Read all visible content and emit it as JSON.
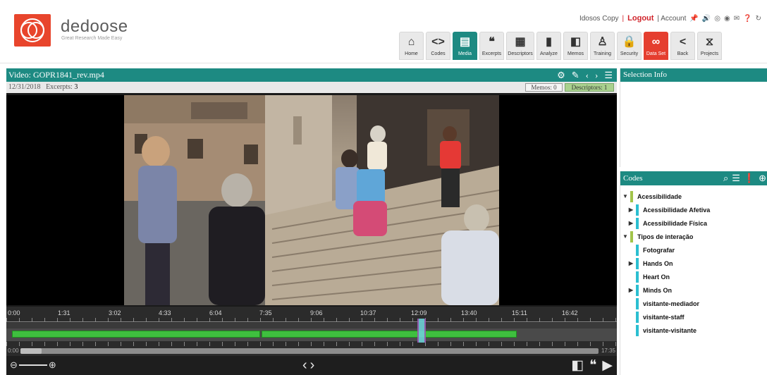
{
  "brand": {
    "name": "dedoose",
    "tagline": "Great Research Made Easy"
  },
  "top_links": {
    "user": "Idosos Copy",
    "separator": "|",
    "logout": "Logout",
    "account": "| Account"
  },
  "nav": [
    {
      "label": "Home",
      "icon": "home-icon"
    },
    {
      "label": "Codes",
      "icon": "codes-icon"
    },
    {
      "label": "Media",
      "icon": "media-icon",
      "active": true
    },
    {
      "label": "Excerpts",
      "icon": "quote-icon"
    },
    {
      "label": "Descriptors",
      "icon": "clipboard-icon"
    },
    {
      "label": "Analyze",
      "icon": "bar-chart-icon"
    },
    {
      "label": "Memos",
      "icon": "memo-icon"
    },
    {
      "label": "Training",
      "icon": "training-icon"
    },
    {
      "label": "Security",
      "icon": "lock-icon"
    },
    {
      "label": "Data Set",
      "icon": "binoculars-icon"
    },
    {
      "label": "Back",
      "icon": "back-icon"
    },
    {
      "label": "Projects",
      "icon": "projects-icon"
    }
  ],
  "video": {
    "title": "Video: GOPR1841_rev.mp4",
    "date": "12/31/2018",
    "excerpts_label": "Excerpts:",
    "excerpts_count": "3",
    "memos_tag": "Memos: 0",
    "descriptors_tag": "Descriptors: 1",
    "timeline_ticks": [
      "0:00",
      "1:31",
      "3:02",
      "4:33",
      "6:04",
      "7:35",
      "9:06",
      "10:37",
      "12:09",
      "13:40",
      "15:11",
      "16:42"
    ],
    "scroll_start": "0:00",
    "scroll_end": "17:35"
  },
  "selection_info": {
    "title": "Selection Info"
  },
  "codes": {
    "title": "Codes",
    "items": [
      {
        "label": "Acessibilidade",
        "level": 0,
        "expander": "▼",
        "color": "lime"
      },
      {
        "label": "Acessibilidade Afetiva",
        "level": 1,
        "expander": "▶",
        "color": "cyan"
      },
      {
        "label": "Acessibilidade Física",
        "level": 1,
        "expander": "▶",
        "color": "cyan"
      },
      {
        "label": "Tipos de interação",
        "level": 0,
        "expander": "▼",
        "color": "lime"
      },
      {
        "label": "Fotografar",
        "level": 1,
        "expander": "",
        "color": "cyan"
      },
      {
        "label": "Hands On",
        "level": 1,
        "expander": "▶",
        "color": "cyan"
      },
      {
        "label": "Heart On",
        "level": 1,
        "expander": "",
        "color": "cyan"
      },
      {
        "label": "Minds On",
        "level": 1,
        "expander": "▶",
        "color": "cyan"
      },
      {
        "label": "visitante-mediador",
        "level": 1,
        "expander": "",
        "color": "cyan"
      },
      {
        "label": "visitante-staff",
        "level": 1,
        "expander": "",
        "color": "cyan"
      },
      {
        "label": "visitante-visitante",
        "level": 1,
        "expander": "",
        "color": "cyan"
      }
    ]
  },
  "colors": {
    "teal": "#1d8a82",
    "red": "#e53e2f",
    "green": "#3fbf3f"
  }
}
